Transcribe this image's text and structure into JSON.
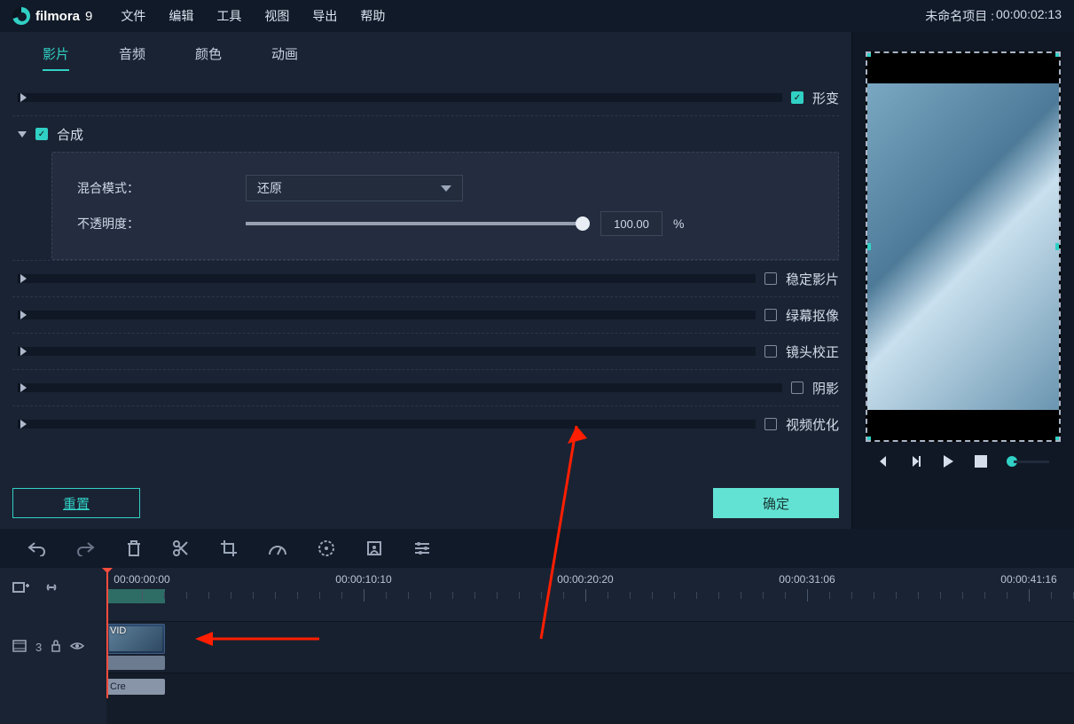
{
  "logo_text": "filmora",
  "logo_version": "9",
  "menus": [
    "文件",
    "编辑",
    "工具",
    "视图",
    "导出",
    "帮助"
  ],
  "project_label": "未命名项目 :",
  "project_time": "00:00:02:13",
  "tabs": [
    "影片",
    "音频",
    "颜色",
    "动画"
  ],
  "active_tab": 0,
  "sections": {
    "transform": {
      "label": "形变",
      "checked": true
    },
    "composite": {
      "label": "合成",
      "checked": true
    },
    "stabilize": {
      "label": "稳定影片",
      "checked": false
    },
    "chroma": {
      "label": "绿幕抠像",
      "checked": false
    },
    "lens": {
      "label": "镜头校正",
      "checked": false
    },
    "shadow": {
      "label": "阴影",
      "checked": false
    },
    "enhance": {
      "label": "视频优化",
      "checked": false
    }
  },
  "composite": {
    "blend_label": "混合模式：",
    "blend_value": "还原",
    "opacity_label": "不透明度：",
    "opacity_value": "100.00",
    "opacity_unit": "%"
  },
  "buttons": {
    "reset": "重置",
    "ok": "确定"
  },
  "timeline": {
    "labels": [
      "00:00:00:00",
      "00:00:10:10",
      "00:00:20:20",
      "00:00:31:06",
      "00:00:41:16"
    ],
    "track_name": "3",
    "clip_label": "VID",
    "clip2_label": "Cre"
  }
}
